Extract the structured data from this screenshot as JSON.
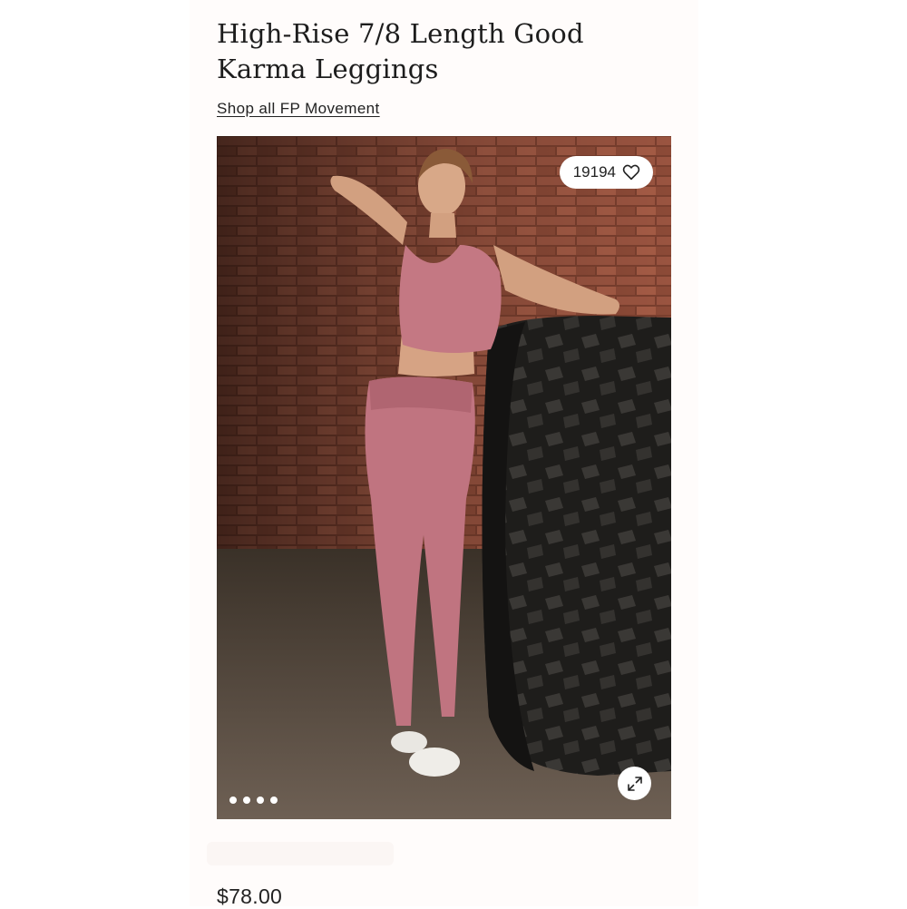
{
  "product": {
    "title": "High-Rise 7/8 Length Good Karma Leggings",
    "shop_all_link": "Shop all FP Movement",
    "price": "$78.00"
  },
  "gallery": {
    "favorites_count": "19194",
    "image_count": 4,
    "active_index": 0,
    "icons": {
      "favorite": "heart-icon",
      "expand": "expand-icon"
    }
  },
  "colors": {
    "page_background": "#fffcfb",
    "text": "#1d1d1d",
    "legging_pink": "#c07480",
    "brick": "#8a4a36",
    "overlay_white": "#ffffff"
  }
}
